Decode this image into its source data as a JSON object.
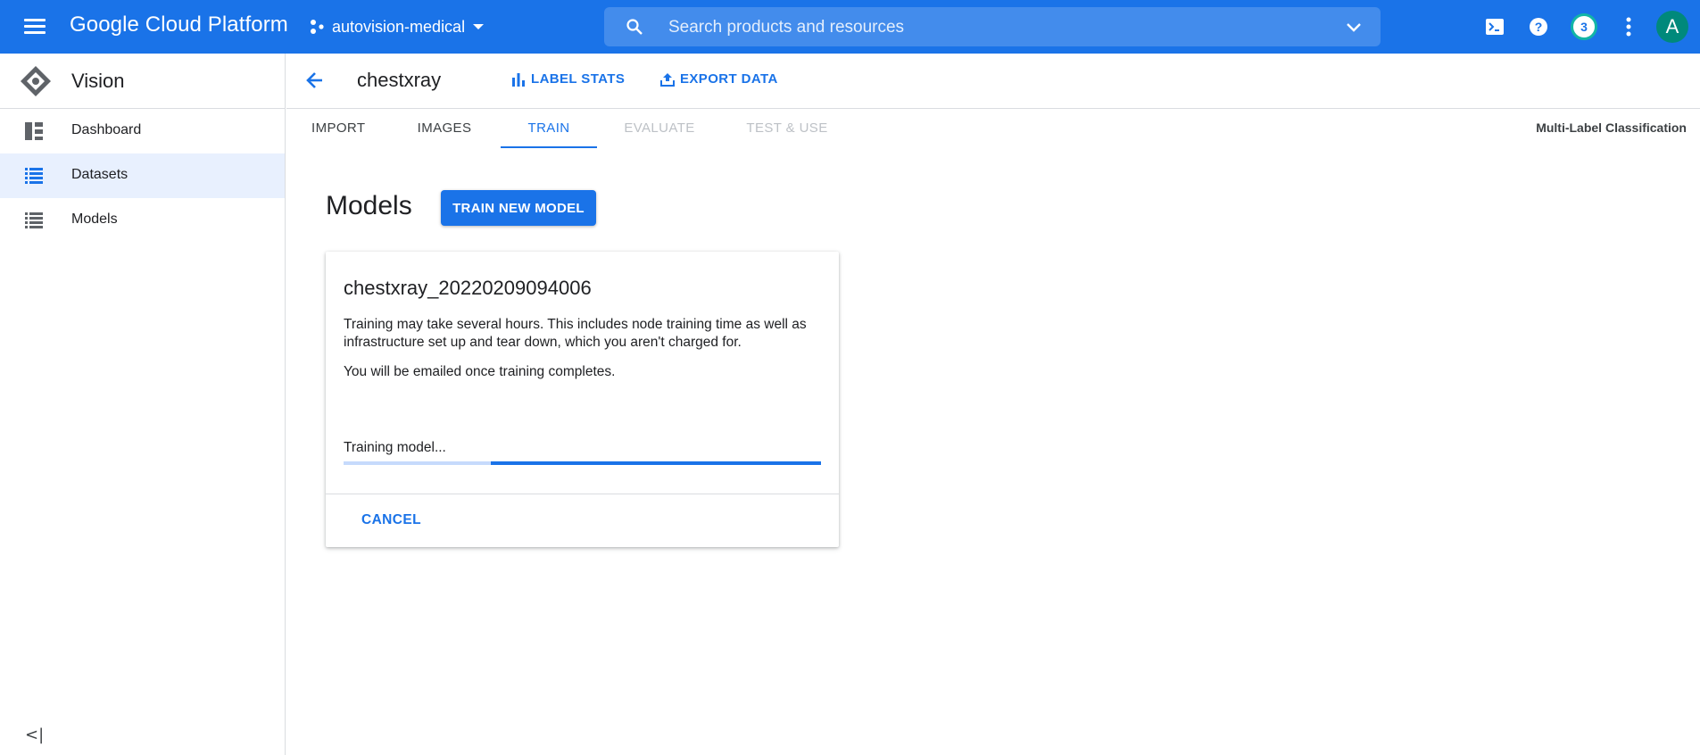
{
  "topbar": {
    "logo": "Google Cloud Platform",
    "project": "autovision-medical",
    "search_placeholder": "Search products and resources",
    "notification_count": "3",
    "avatar_letter": "A"
  },
  "sidebar": {
    "product": "Vision",
    "items": [
      {
        "label": "Dashboard",
        "icon": "dashboard-icon",
        "active": false
      },
      {
        "label": "Datasets",
        "icon": "list-icon",
        "active": true
      },
      {
        "label": "Models",
        "icon": "list-icon",
        "active": false
      }
    ],
    "collapse_glyph": "<|"
  },
  "header": {
    "dataset_name": "chestxray",
    "label_stats": "LABEL STATS",
    "export_data": "EXPORT DATA"
  },
  "tabs": {
    "items": [
      {
        "label": "IMPORT",
        "state": "normal"
      },
      {
        "label": "IMAGES",
        "state": "normal"
      },
      {
        "label": "TRAIN",
        "state": "active"
      },
      {
        "label": "EVALUATE",
        "state": "disabled"
      },
      {
        "label": "TEST & USE",
        "state": "disabled"
      }
    ],
    "classification_type": "Multi-Label Classification"
  },
  "models": {
    "title": "Models",
    "train_new_model": "TRAIN NEW MODEL",
    "card": {
      "model_name": "chestxray_20220209094006",
      "description": "Training may take several hours. This includes node training time as well as infrastructure set up and tear down, which you aren't charged for.",
      "email_note": "You will be emailed once training completes.",
      "status": "Training model...",
      "progress_indeterminate": true,
      "cancel": "CANCEL"
    }
  },
  "colors": {
    "brand_blue": "#1a73e8",
    "active_nav_bg": "#e8f0fe",
    "progress_track": "#c6dafc",
    "badge_ring": "#12b5a6",
    "avatar_bg": "#00897b"
  }
}
